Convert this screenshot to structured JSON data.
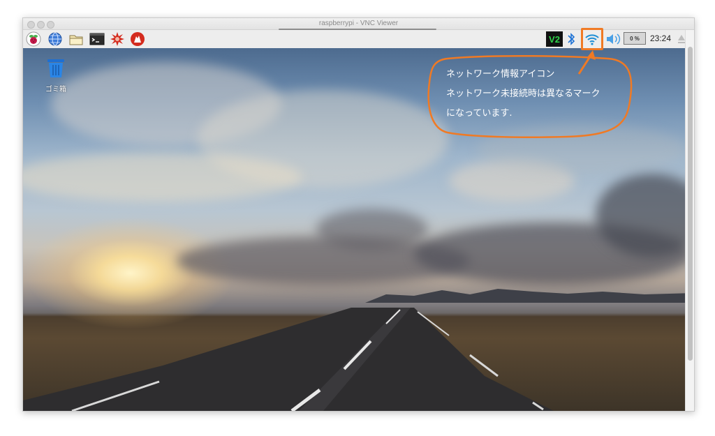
{
  "window": {
    "title": "raspberrypi - VNC Viewer"
  },
  "taskbar": {
    "launchers": [
      {
        "name": "raspberry-menu-icon"
      },
      {
        "name": "web-browser-icon"
      },
      {
        "name": "file-manager-icon"
      },
      {
        "name": "terminal-icon"
      },
      {
        "name": "mathematica-icon"
      },
      {
        "name": "wolfram-icon"
      }
    ],
    "tray": {
      "vnc_label": "V2",
      "cpu_usage": "0 %",
      "clock": "23:24"
    }
  },
  "desktop": {
    "trash_label": "ゴミ箱"
  },
  "annotation": {
    "lines": [
      "ネットワーク情報アイコン",
      "ネットワーク未接続時は異なるマーク",
      "になっています."
    ],
    "color": "#f07a24"
  }
}
